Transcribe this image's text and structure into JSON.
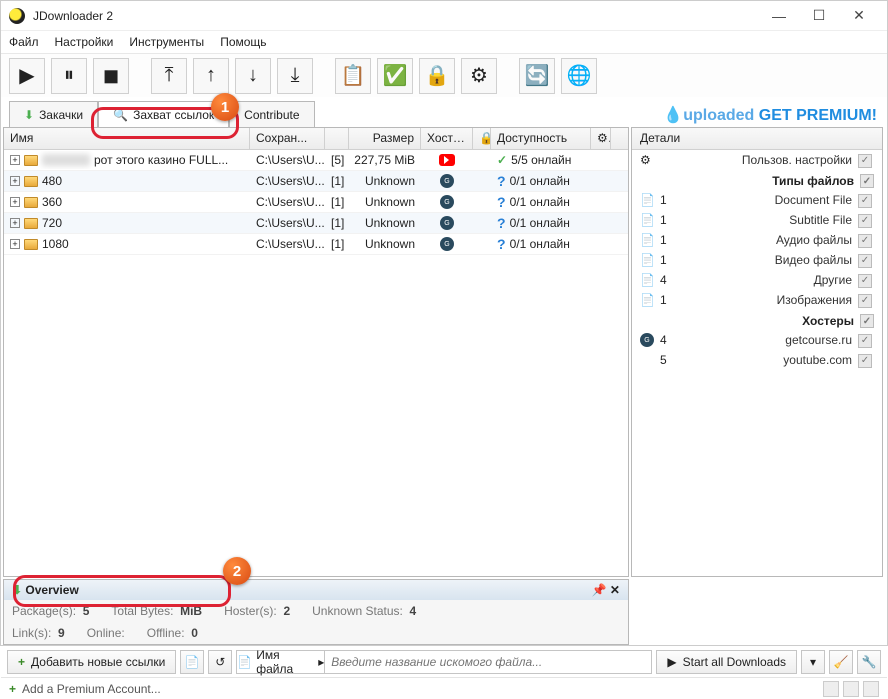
{
  "window": {
    "title": "JDownloader 2"
  },
  "menu": {
    "file": "Файл",
    "settings": "Настройки",
    "tools": "Инструменты",
    "help": "Помощь"
  },
  "tabs": {
    "downloads": "Закачки",
    "linkgrabber": "Захват ссылок",
    "contribute": "Contribute"
  },
  "premium": {
    "brand": "uploaded",
    "cta": " GET PREMIUM!"
  },
  "columns": {
    "name": "Имя",
    "save": "Сохран...",
    "size": "Размер",
    "hoster": "Хостер",
    "avail": "Доступность"
  },
  "rows": [
    {
      "name": "рот этого казино FULL...",
      "save": "C:\\Users\\U...",
      "count": "[5]",
      "size": "227,75 MiB",
      "host": "yt",
      "avail": "5/5 онлайн",
      "status": "ok"
    },
    {
      "name": "480",
      "save": "C:\\Users\\U...",
      "count": "[1]",
      "size": "Unknown",
      "host": "gc",
      "avail": "0/1 онлайн",
      "status": "q"
    },
    {
      "name": "360",
      "save": "C:\\Users\\U...",
      "count": "[1]",
      "size": "Unknown",
      "host": "gc",
      "avail": "0/1 онлайн",
      "status": "q"
    },
    {
      "name": "720",
      "save": "C:\\Users\\U...",
      "count": "[1]",
      "size": "Unknown",
      "host": "gc",
      "avail": "0/1 онлайн",
      "status": "q"
    },
    {
      "name": "1080",
      "save": "C:\\Users\\U...",
      "count": "[1]",
      "size": "Unknown",
      "host": "gc",
      "avail": "0/1 онлайн",
      "status": "q"
    }
  ],
  "details": {
    "header": "Детали",
    "user_settings": "Пользов. настройки",
    "types_title": "Типы файлов",
    "types": [
      {
        "count": "1",
        "label": "Document File"
      },
      {
        "count": "1",
        "label": "Subtitle File"
      },
      {
        "count": "1",
        "label": "Аудио файлы"
      },
      {
        "count": "1",
        "label": "Видео файлы"
      },
      {
        "count": "4",
        "label": "Другие"
      },
      {
        "count": "1",
        "label": "Изображения"
      }
    ],
    "hosters_title": "Хостеры",
    "hosters": [
      {
        "count": "4",
        "label": "getcourse.ru"
      },
      {
        "count": "5",
        "label": "youtube.com"
      }
    ]
  },
  "overview": {
    "title": "Overview",
    "packages_l": "Package(s):",
    "packages_v": "5",
    "bytes_l": "Total Bytes:",
    "bytes_v": "MiB",
    "hosters_l": "Hoster(s):",
    "hosters_v": "2",
    "unknown_l": "Unknown Status:",
    "unknown_v": "4",
    "links_l": "Link(s):",
    "links_v": "9",
    "online_l": "Online:",
    "offline_l": "Offline:",
    "offline_v": "0"
  },
  "buttons": {
    "add_links": "Добавить новые ссылки",
    "filename": "Имя файла",
    "search_ph": "Введите название искомого файла...",
    "start_all": "Start all Downloads",
    "add_premium": "Add a Premium Account..."
  },
  "markers": {
    "one": "1",
    "two": "2"
  }
}
